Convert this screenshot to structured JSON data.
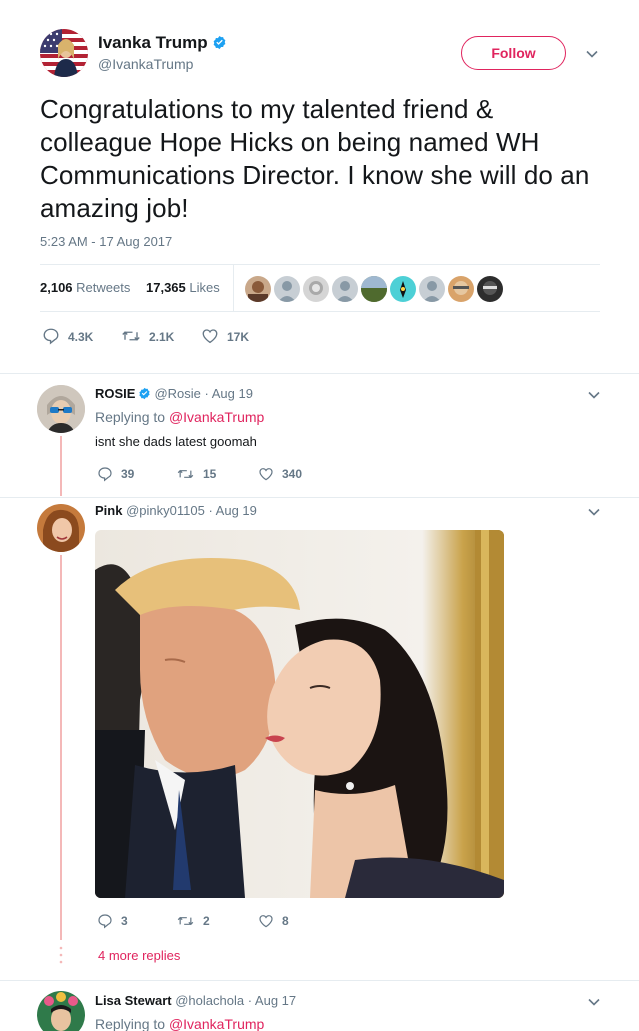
{
  "main_tweet": {
    "display_name": "Ivanka Trump",
    "screen_name": "@IvankaTrump",
    "follow_label": "Follow",
    "text": "Congratulations to my talented friend & colleague Hope Hicks on being named WH Communications Director. I know she will do an amazing job!",
    "timestamp": "5:23 AM - 17 Aug 2017",
    "retweets_count": "2,106",
    "retweets_label": "Retweets",
    "likes_count": "17,365",
    "likes_label": "Likes",
    "actions": {
      "reply": "4.3K",
      "retweet": "2.1K",
      "like": "17K"
    }
  },
  "replies": [
    {
      "display_name": "ROSIE",
      "screen_name": "@Rosie",
      "date": "· Aug 19",
      "replying_prefix": "Replying to",
      "replying_to": "@IvankaTrump",
      "text": "isnt she dads latest goomah",
      "actions": {
        "reply": "39",
        "retweet": "15",
        "like": "340"
      }
    },
    {
      "display_name": "Pink",
      "screen_name": "@pinky01105",
      "date": "· Aug 19",
      "actions": {
        "reply": "3",
        "retweet": "2",
        "like": "8"
      }
    },
    {
      "display_name": "Lisa Stewart",
      "screen_name": "@holachola",
      "date": "· Aug 17",
      "replying_prefix": "Replying to",
      "replying_to": "@IvankaTrump"
    }
  ],
  "more_replies_label": "4 more replies",
  "colors": {
    "accent": "#e0245e",
    "verified": "#1da1f2",
    "muted": "#657786",
    "thread": "#f4b8b8"
  },
  "icons": [
    "verified-badge-icon",
    "chevron-down-icon",
    "reply-icon",
    "retweet-icon",
    "like-icon"
  ]
}
